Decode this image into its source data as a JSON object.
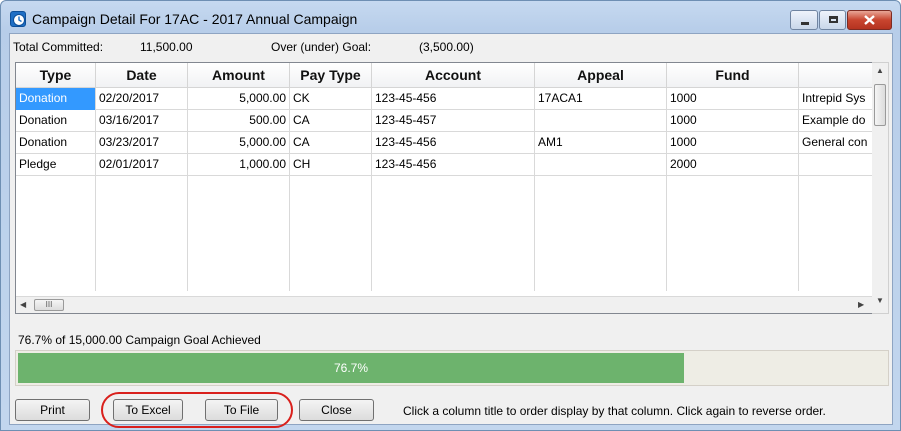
{
  "window": {
    "title": "Campaign Detail For 17AC - 2017 Annual Campaign",
    "controls": {
      "minimize": "minimize",
      "maximize": "maximize",
      "close": "close"
    }
  },
  "summary": {
    "committed_label": "Total Committed:",
    "committed_value": "11,500.00",
    "goal_label": "Over (under) Goal:",
    "goal_value": "(3,500.00)"
  },
  "table": {
    "columns": [
      "Type",
      "Date",
      "Amount",
      "Pay Type",
      "Account",
      "Appeal",
      "Fund",
      ""
    ],
    "rows": [
      {
        "type": "Donation",
        "date": "02/20/2017",
        "amount": "5,000.00",
        "pay_type": "CK",
        "account": "123-45-456",
        "appeal": "17ACA1",
        "fund": "1000",
        "note": "Intrepid Sys"
      },
      {
        "type": "Donation",
        "date": "03/16/2017",
        "amount": "500.00",
        "pay_type": "CA",
        "account": "123-45-457",
        "appeal": "",
        "fund": "1000",
        "note": "Example do"
      },
      {
        "type": "Donation",
        "date": "03/23/2017",
        "amount": "5,000.00",
        "pay_type": "CA",
        "account": "123-45-456",
        "appeal": "AM1",
        "fund": "1000",
        "note": "General con"
      },
      {
        "type": "Pledge",
        "date": "02/01/2017",
        "amount": "1,000.00",
        "pay_type": "CH",
        "account": "123-45-456",
        "appeal": "",
        "fund": "2000",
        "note": ""
      }
    ],
    "selected_row": 0,
    "selection_color": "#3399ff"
  },
  "scrollbars": {
    "h_thumb_label": "III"
  },
  "goal": {
    "text": "76.7% of 15,000.00 Campaign Goal Achieved",
    "progress_label": "76.7%",
    "progress_fraction": 0.767,
    "fill_color": "#6db36d"
  },
  "buttons": {
    "print": "Print",
    "to_excel": "To Excel",
    "to_file": "To File",
    "close": "Close"
  },
  "hint": "Click a column title to order display by that column.  Click again to reverse order.",
  "annotation": {
    "ring_color": "#d9201c"
  }
}
